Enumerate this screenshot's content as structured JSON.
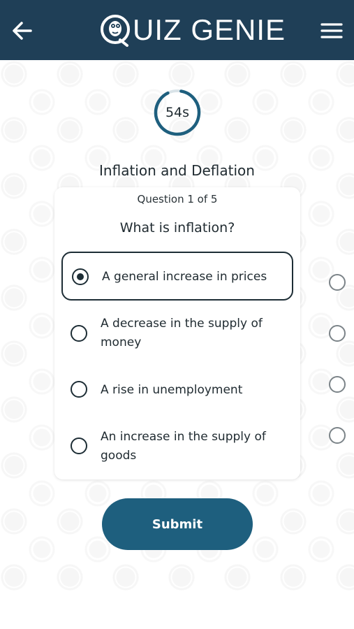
{
  "header": {
    "brand_text": "UIZ GENIE",
    "back_icon": "arrow-left-icon",
    "menu_icon": "hamburger-menu-icon",
    "logo_icon": "genie-q-logo-icon",
    "background_color": "#1f3f57"
  },
  "timer": {
    "label": "54s",
    "ring_color": "#1e5f7e"
  },
  "quiz": {
    "title": "Inflation and Deflation",
    "counter": "Question 1 of 5",
    "question": "What is inflation?",
    "options": [
      {
        "label": "A general increase in prices",
        "selected": true
      },
      {
        "label": "A decrease in the supply of money",
        "selected": false
      },
      {
        "label": "A rise in unemployment",
        "selected": false
      },
      {
        "label": "An increase in the supply of goods",
        "selected": false
      }
    ]
  },
  "actions": {
    "submit_label": "Submit",
    "submit_color": "#1e5f7e"
  }
}
